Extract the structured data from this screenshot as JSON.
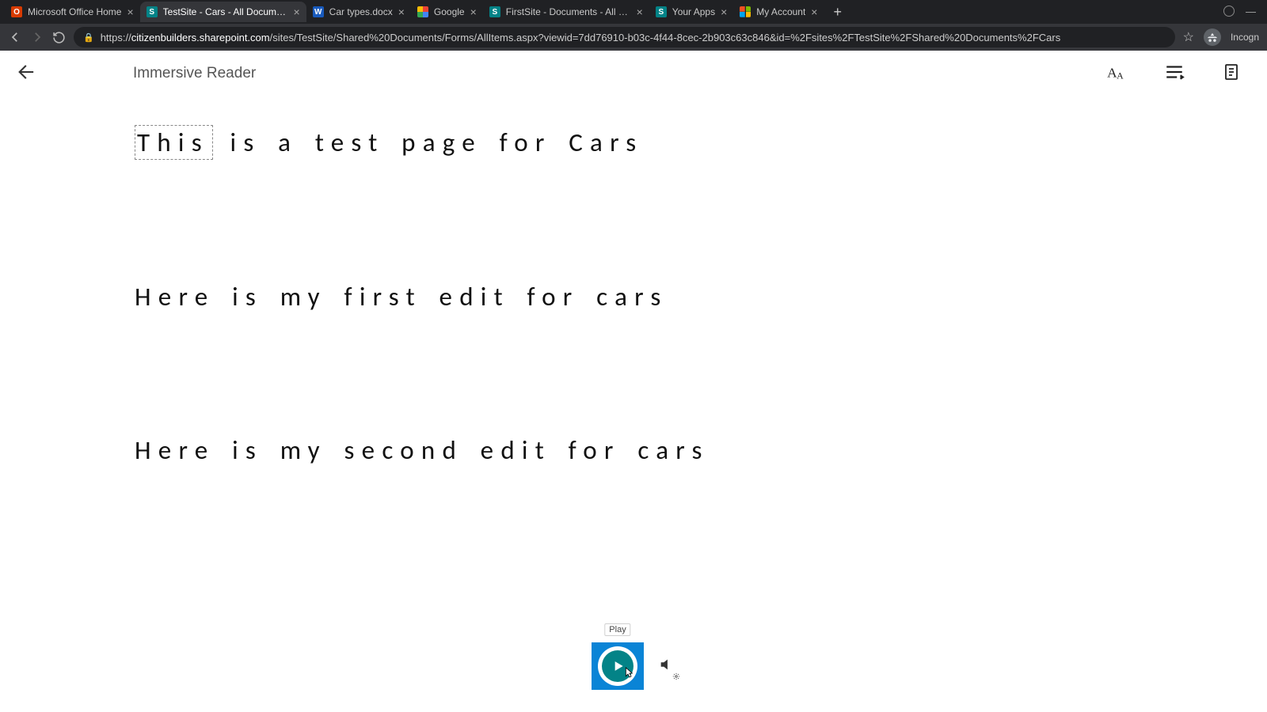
{
  "browser": {
    "tabs": [
      {
        "title": "Microsoft Office Home",
        "fav": "office"
      },
      {
        "title": "TestSite - Cars - All Documents",
        "fav": "sp",
        "active": true
      },
      {
        "title": "Car types.docx",
        "fav": "word"
      },
      {
        "title": "Google",
        "fav": "google"
      },
      {
        "title": "FirstSite - Documents - All Docu…",
        "fav": "sp"
      },
      {
        "title": "Your Apps",
        "fav": "sp"
      },
      {
        "title": "My Account",
        "fav": "ms"
      }
    ],
    "url_host": "citizenbuilders.sharepoint.com",
    "url_path": "/sites/TestSite/Shared%20Documents/Forms/AllItems.aspx?viewid=7dd76910-b03c-4f44-8cec-2b903c63c846&id=%2Fsites%2FTestSite%2FShared%20Documents%2FCars",
    "profile_label": "Incogn"
  },
  "reader": {
    "title": "Immersive Reader",
    "content_highlight_word": "This",
    "line1_rest": " is a test page for Cars",
    "line2": "Here is my first edit for cars",
    "line3": "Here is my second edit for cars"
  },
  "controls": {
    "play_tooltip": "Play"
  }
}
